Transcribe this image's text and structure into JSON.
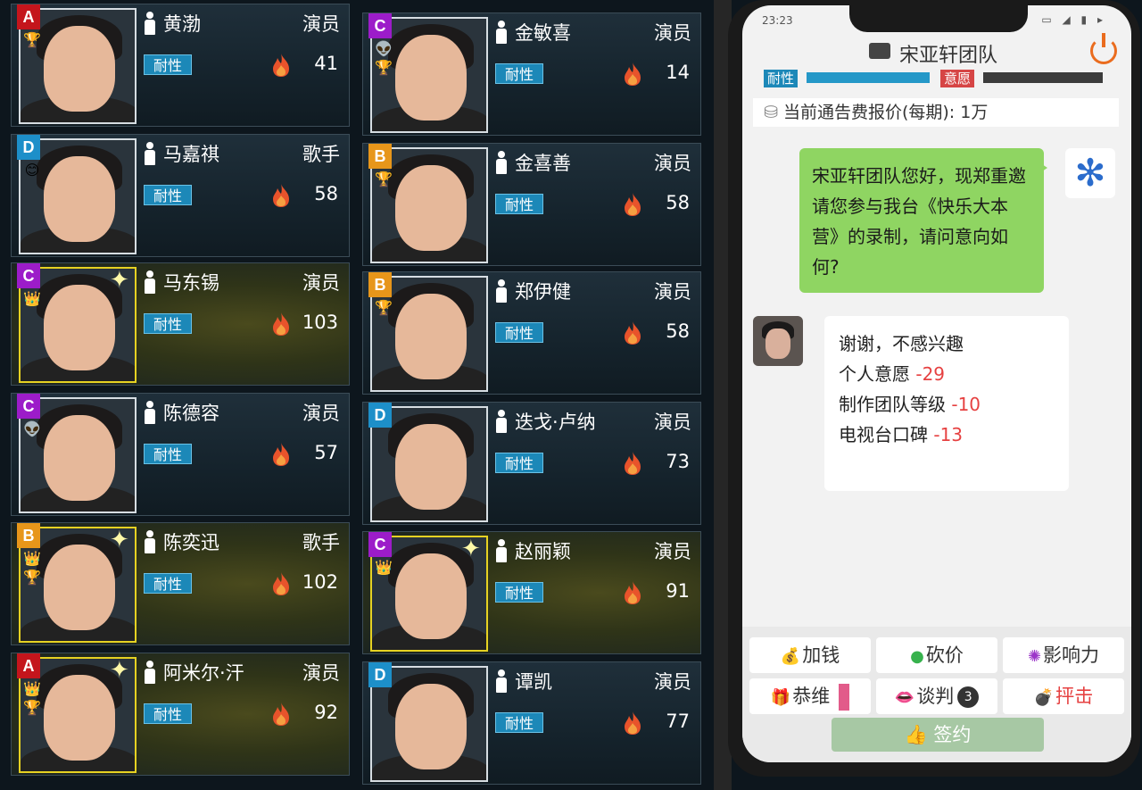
{
  "cards": [
    {
      "tier": "A",
      "name": "黄渤",
      "role": "演员",
      "endure": "耐性",
      "heat": "41",
      "gold": false,
      "badges": [
        "🏆"
      ]
    },
    {
      "tier": "D",
      "name": "马嘉祺",
      "role": "歌手",
      "endure": "耐性",
      "heat": "58",
      "gold": false,
      "badges": [
        "😊"
      ]
    },
    {
      "tier": "C",
      "name": "马东锡",
      "role": "演员",
      "endure": "耐性",
      "heat": "103",
      "gold": true,
      "badges": [
        "👑"
      ]
    },
    {
      "tier": "C",
      "name": "陈德容",
      "role": "演员",
      "endure": "耐性",
      "heat": "57",
      "gold": false,
      "badges": [
        "👽"
      ]
    },
    {
      "tier": "B",
      "name": "陈奕迅",
      "role": "歌手",
      "endure": "耐性",
      "heat": "102",
      "gold": true,
      "badges": [
        "👑",
        "🏆"
      ]
    },
    {
      "tier": "A",
      "name": "阿米尔·汗",
      "role": "演员",
      "endure": "耐性",
      "heat": "92",
      "gold": true,
      "badges": [
        "👑",
        "🏆"
      ]
    },
    {
      "tier": "C",
      "name": "金敏喜",
      "role": "演员",
      "endure": "耐性",
      "heat": "14",
      "gold": false,
      "badges": [
        "👽",
        "🏆"
      ]
    },
    {
      "tier": "B",
      "name": "金喜善",
      "role": "演员",
      "endure": "耐性",
      "heat": "58",
      "gold": false,
      "badges": [
        "🏆"
      ]
    },
    {
      "tier": "B",
      "name": "郑伊健",
      "role": "演员",
      "endure": "耐性",
      "heat": "58",
      "gold": false,
      "badges": [
        "🏆"
      ]
    },
    {
      "tier": "D",
      "name": "迭戈·卢纳",
      "role": "演员",
      "endure": "耐性",
      "heat": "73",
      "gold": false,
      "badges": []
    },
    {
      "tier": "C",
      "name": "赵丽颖",
      "role": "演员",
      "endure": "耐性",
      "heat": "91",
      "gold": true,
      "badges": [
        "👑"
      ]
    },
    {
      "tier": "D",
      "name": "谭凯",
      "role": "演员",
      "endure": "耐性",
      "heat": "77",
      "gold": false,
      "badges": []
    }
  ],
  "phone": {
    "time": "23:23",
    "team": "宋亚轩团队",
    "bar_endure_label": "耐性",
    "bar_will_label": "意愿",
    "endure_level": 1.0,
    "will_level": 0.0,
    "fee": "当前通告费报价(每期): 1万",
    "out_msg": "宋亚轩团队您好，现郑重邀请您参与我台《快乐大本营》的录制，请问意向如何?",
    "in_msg": {
      "line1": "谢谢，不感兴趣",
      "line2_label": "个人意愿",
      "line2_val": "-29",
      "line3_label": "制作团队等级",
      "line3_val": "-10",
      "line4_label": "电视台口碑",
      "line4_val": "-13"
    },
    "actions": {
      "add_money": "加钱",
      "bargain": "砍价",
      "influence": "影响力",
      "flatter": "恭维",
      "negotiate": "谈判",
      "negotiate_count": "3",
      "attack": "抨击",
      "sign": "签约"
    }
  }
}
